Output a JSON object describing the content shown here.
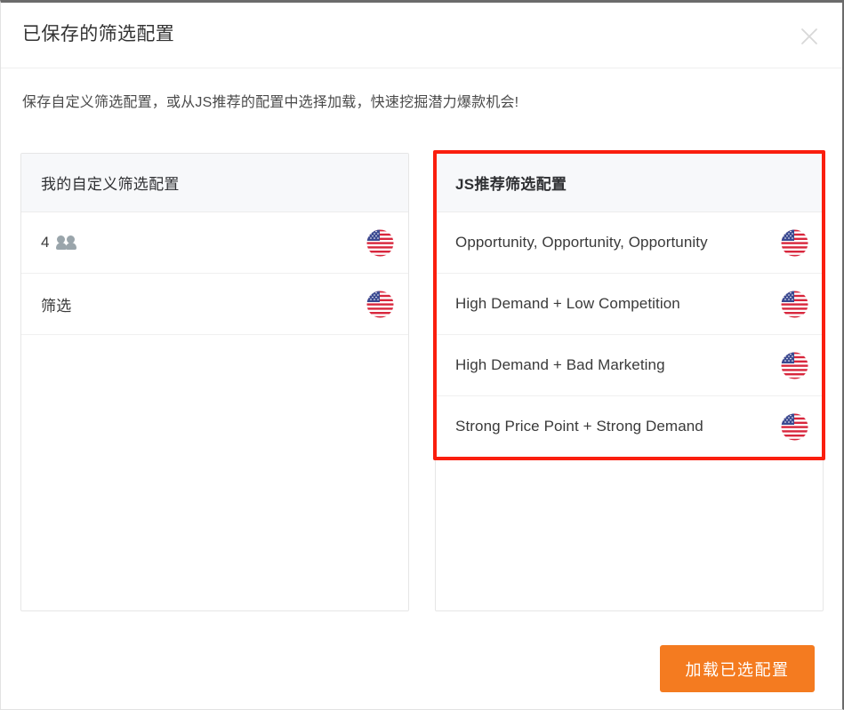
{
  "dialog": {
    "title": "已保存的筛选配置",
    "description": "保存自定义筛选配置，或从JS推荐的配置中选择加载，快速挖掘潜力爆款机会!",
    "close_icon": "close-icon"
  },
  "panels": {
    "custom": {
      "header": "我的自定义筛选配置",
      "items": [
        {
          "label": "4",
          "icon": "people-icon",
          "flag": "us-flag-icon"
        },
        {
          "label": "筛选",
          "icon": "",
          "flag": "us-flag-icon"
        }
      ]
    },
    "recommended": {
      "header": "JS推荐筛选配置",
      "items": [
        {
          "label": "Opportunity, Opportunity, Opportunity",
          "flag": "us-flag-icon"
        },
        {
          "label": "High Demand + Low Competition",
          "flag": "us-flag-icon"
        },
        {
          "label": "High Demand + Bad Marketing",
          "flag": "us-flag-icon"
        },
        {
          "label": "Strong Price Point + Strong Demand",
          "flag": "us-flag-icon"
        }
      ]
    }
  },
  "footer": {
    "load_button": "加载已选配置"
  },
  "colors": {
    "accent_orange": "#f47b20",
    "highlight_red": "#fa1e0e",
    "panel_header_bg": "#f7f8fa",
    "border": "#e6e6e6",
    "text": "#333333"
  }
}
